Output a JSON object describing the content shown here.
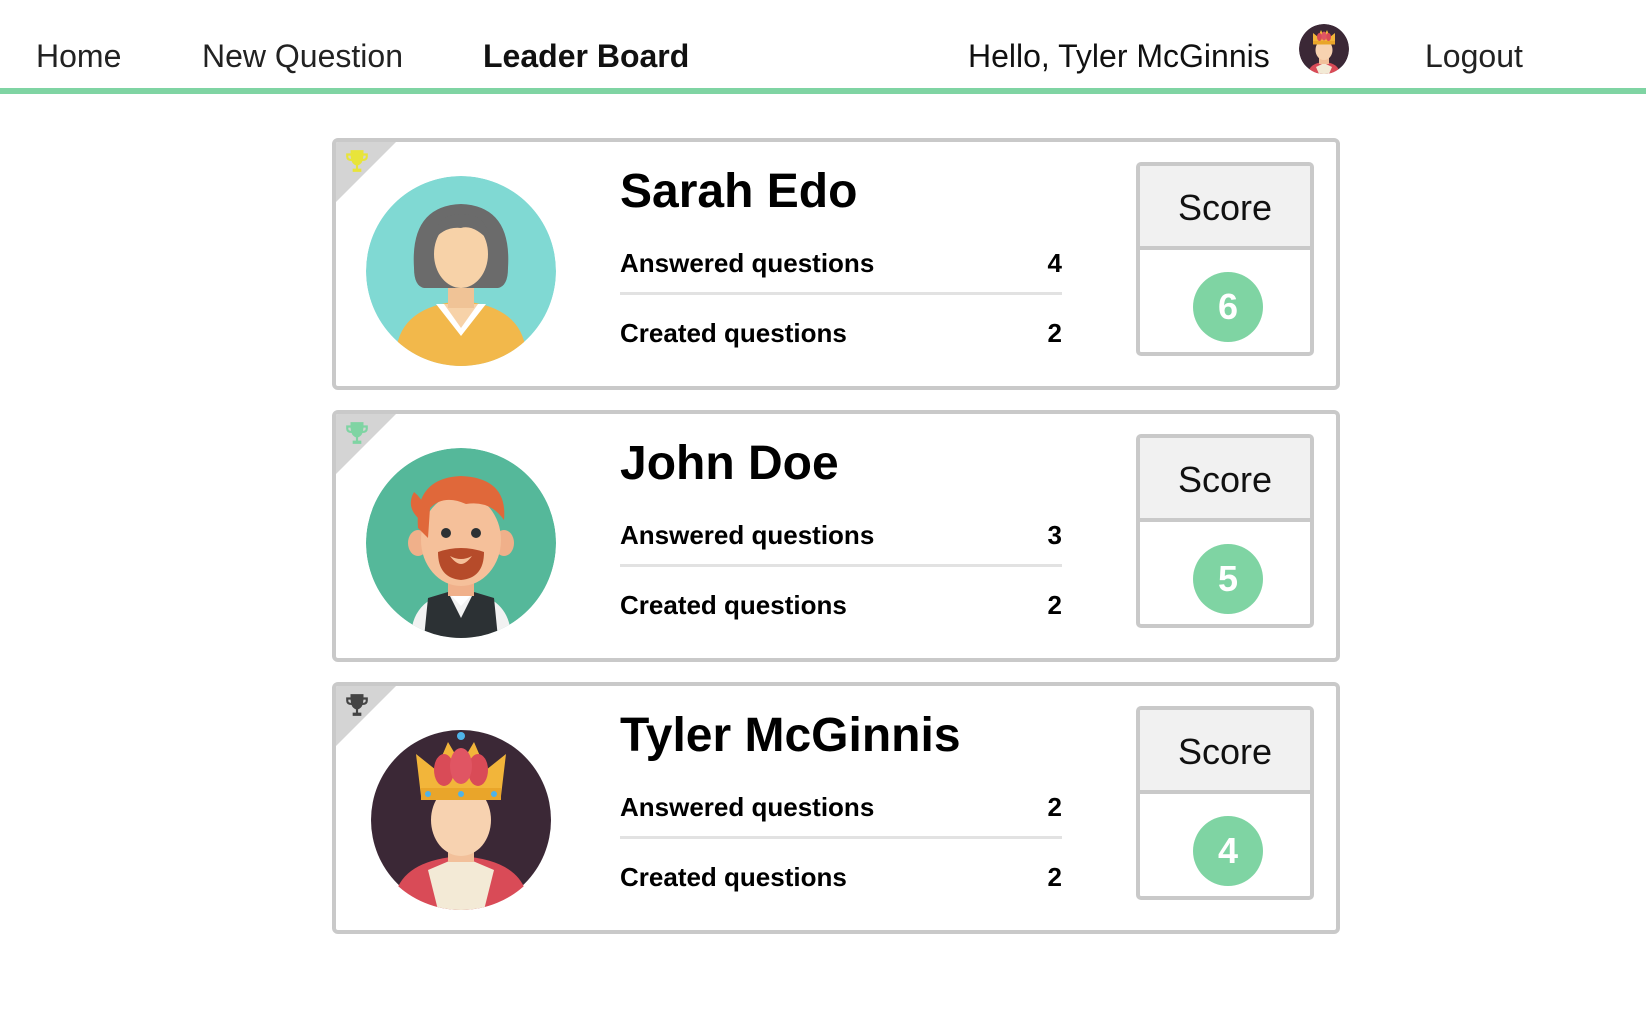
{
  "nav": {
    "home": "Home",
    "new_question": "New Question",
    "leader_board": "Leader Board",
    "greeting": "Hello, Tyler McGinnis",
    "logout": "Logout",
    "active_color": "#7fd4a3"
  },
  "score_label": "Score",
  "leaders": [
    {
      "rank": 1,
      "name": "Sarah Edo",
      "answered_label": "Answered questions",
      "answered": "4",
      "created_label": "Created questions",
      "created": "2",
      "score": "6",
      "trophy_color": "#e8e43a",
      "avatar": "woman-avatar-icon"
    },
    {
      "rank": 2,
      "name": "John Doe",
      "answered_label": "Answered questions",
      "answered": "3",
      "created_label": "Created questions",
      "created": "2",
      "score": "5",
      "trophy_color": "#7fd4a3",
      "avatar": "bearded-man-avatar-icon"
    },
    {
      "rank": 3,
      "name": "Tyler McGinnis",
      "answered_label": "Answered questions",
      "answered": "2",
      "created_label": "Created questions",
      "created": "2",
      "score": "4",
      "trophy_color": "#444444",
      "avatar": "king-avatar-icon"
    }
  ]
}
